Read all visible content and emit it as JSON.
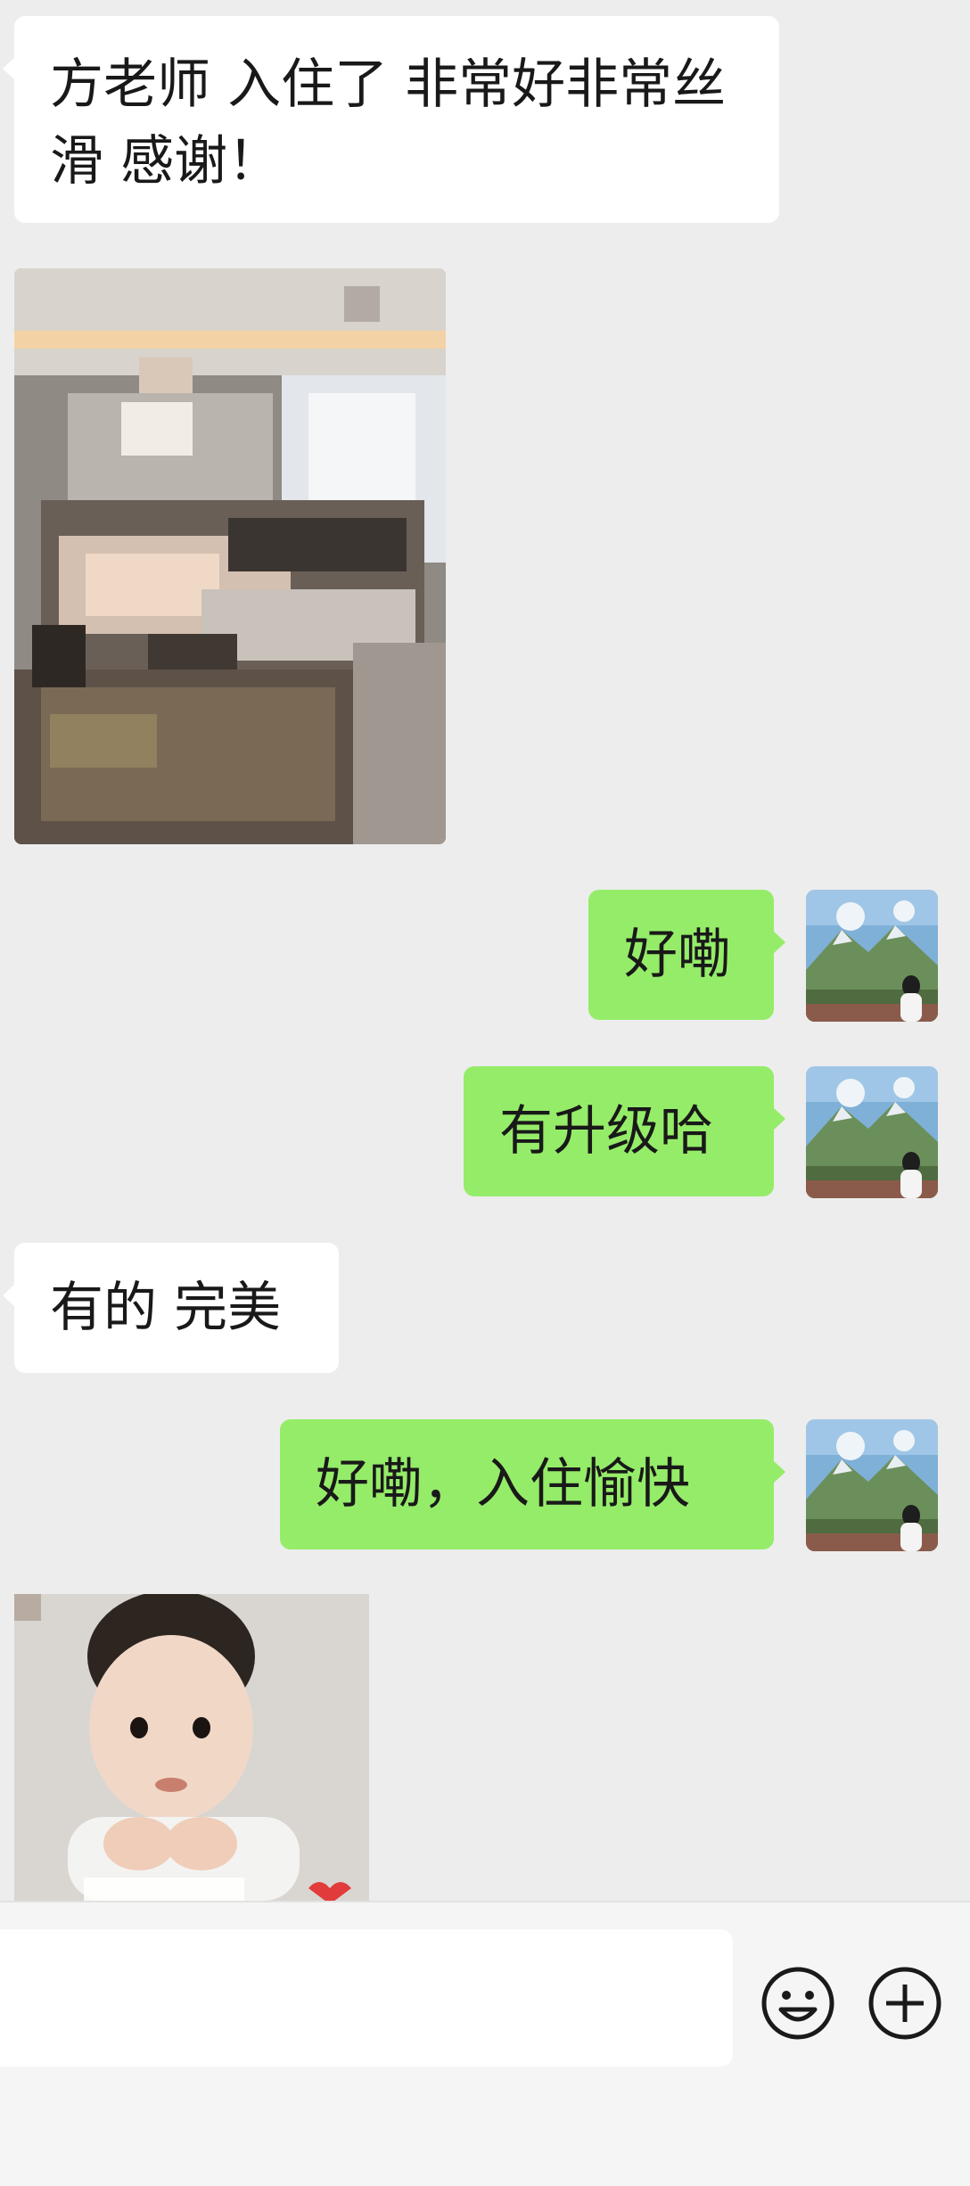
{
  "messages": [
    {
      "side": "in",
      "text": "方老师 入住了 非常好非常丝滑 感谢！"
    },
    {
      "side": "in",
      "kind": "image",
      "description": "blurred-room-photo"
    },
    {
      "side": "out",
      "text": "好嘞"
    },
    {
      "side": "out",
      "text": "有升级哈"
    },
    {
      "side": "in",
      "text": "有的 完美"
    },
    {
      "side": "out",
      "text": "好嘞，入住愉快"
    },
    {
      "side": "in",
      "kind": "sticker",
      "caption_partial": ""
    }
  ],
  "input": {
    "value": "",
    "placeholder": ""
  },
  "icons": {
    "emoji": "emoji-icon",
    "plus": "plus-icon"
  },
  "colors": {
    "background": "#ededed",
    "incoming_bubble": "#ffffff",
    "outgoing_bubble": "#95ec69",
    "bottom_bar": "#f5f5f5"
  }
}
